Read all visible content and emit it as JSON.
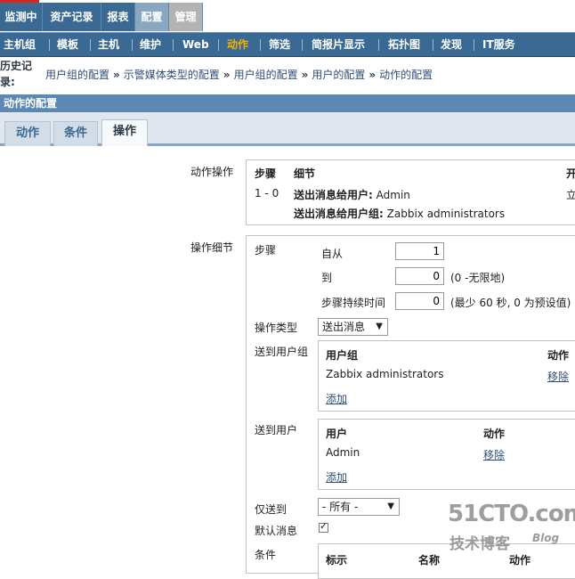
{
  "main_menu": [
    "监测中",
    "资产记录",
    "报表",
    "配置",
    "管理"
  ],
  "sub_menu": [
    "主机组",
    "模板",
    "主机",
    "维护",
    "Web",
    "动作",
    "筛选",
    "简报片显示",
    "拓扑图",
    "发现",
    "IT服务"
  ],
  "history_label": "历史记录:",
  "breadcrumbs": [
    "用户组的配置",
    "示警媒体类型的配置",
    "用户组的配置",
    "用户的配置",
    "动作的配置"
  ],
  "breadcrumb_sep": "»",
  "section_title": "动作的配置",
  "tabs": [
    "动作",
    "条件",
    "操作"
  ],
  "operations": {
    "label": "动作操作",
    "col_step": "步骤",
    "col_detail": "细节",
    "col_start": "开",
    "step_value": "1 - 0",
    "detail_user_label": "送出消息给用户:",
    "detail_user_value": "Admin",
    "detail_group_label": "送出消息给用户组:",
    "detail_group_value": "Zabbix administrators",
    "start_value": "立"
  },
  "details": {
    "label": "操作细节",
    "step_label": "步骤",
    "from_label": "自从",
    "from_value": "1",
    "to_label": "到",
    "to_value": "0",
    "to_hint": "(0 -无限地)",
    "duration_label": "步骤持续时间",
    "duration_value": "0",
    "duration_hint": "(最少 60 秒, 0 为预设值)",
    "op_type_label": "操作类型",
    "op_type_value": "送出消息",
    "send_groups_label": "送到用户组",
    "groups_col_group": "用户组",
    "groups_col_action": "动作",
    "group_name": "Zabbix administrators",
    "group_remove": "移除",
    "groups_add": "添加",
    "send_users_label": "送到用户",
    "users_col_user": "用户",
    "users_col_action": "动作",
    "user_name": "Admin",
    "user_remove": "移除",
    "users_add": "添加",
    "only_to_label": "仅送到",
    "only_to_value": "- 所有 -",
    "default_msg_label": "默认消息",
    "default_msg_checked": true,
    "conditions_label": "条件",
    "cond_col_label": "标示",
    "cond_col_name": "名称",
    "cond_col_action": "动作"
  },
  "watermark": {
    "line1": "51CTO.com",
    "line2": "技术博客",
    "line3": "Blog"
  },
  "colors": {
    "menu_blue": "#3a6a94",
    "active_yellow": "#f2b300",
    "section_blue": "#5c88b3"
  }
}
